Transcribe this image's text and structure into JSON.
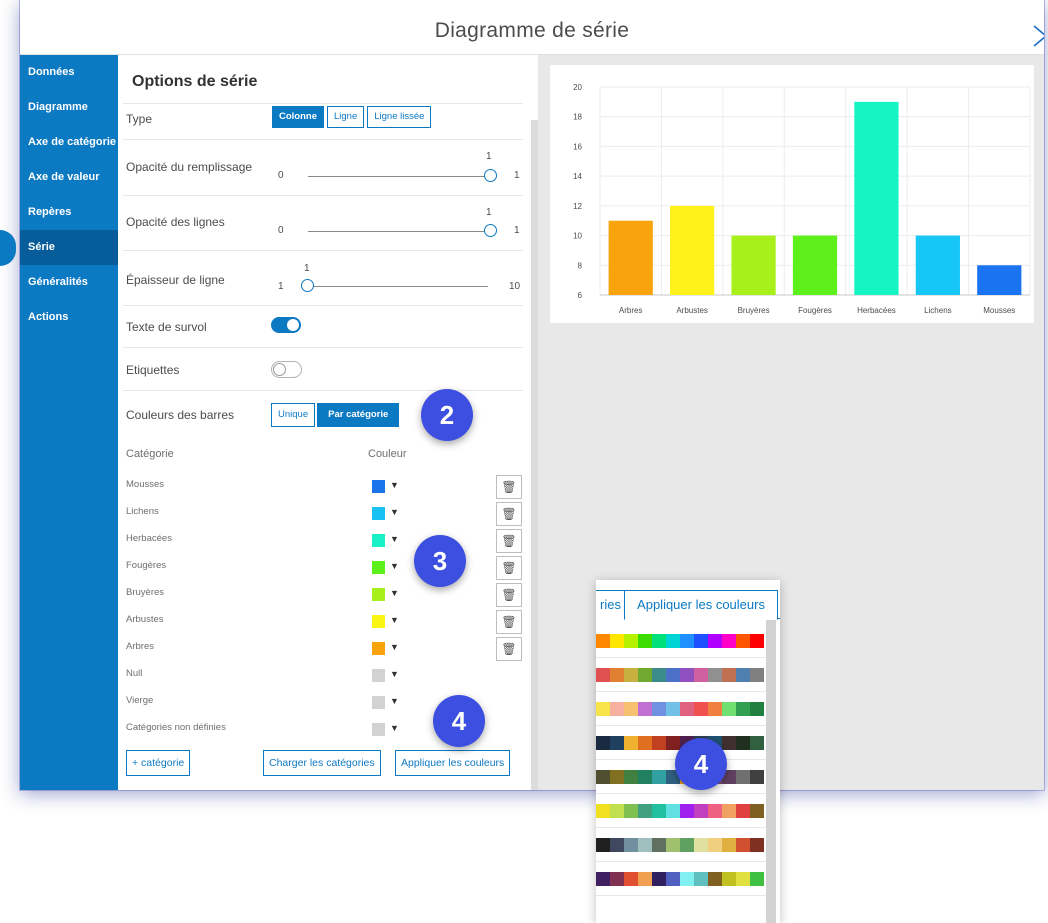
{
  "dialog": {
    "title": "Diagramme de série"
  },
  "sidebar": {
    "items": [
      {
        "label": "Données",
        "active": false
      },
      {
        "label": "Diagramme",
        "active": false
      },
      {
        "label": "Axe de catégorie",
        "active": false
      },
      {
        "label": "Axe de valeur",
        "active": false
      },
      {
        "label": "Repères",
        "active": false
      },
      {
        "label": "Série",
        "active": true
      },
      {
        "label": "Généralités",
        "active": false
      },
      {
        "label": "Actions",
        "active": false
      }
    ]
  },
  "panel": {
    "title": "Options de série",
    "type": {
      "label": "Type",
      "options": [
        "Colonne",
        "Ligne",
        "Ligne lissée"
      ],
      "selected": "Colonne"
    },
    "fill_opacity": {
      "label": "Opacité du remplissage",
      "min": "0",
      "max": "1",
      "value": "1"
    },
    "line_opacity": {
      "label": "Opacité des lignes",
      "min": "0",
      "max": "1",
      "value": "1"
    },
    "line_width": {
      "label": "Épaisseur de ligne",
      "min": "1",
      "max": "10",
      "value": "1"
    },
    "hover_text": {
      "label": "Texte de survol",
      "on": true
    },
    "labels": {
      "label": "Etiquettes",
      "on": false
    },
    "bar_colors": {
      "label": "Couleurs des barres",
      "options": [
        "Unique",
        "Par catégorie"
      ],
      "selected": "Par catégorie"
    },
    "categories_header": {
      "category": "Catégorie",
      "color": "Couleur"
    },
    "categories": [
      {
        "name": "Mousses",
        "color": "#1a73e8",
        "deletable": true
      },
      {
        "name": "Lichens",
        "color": "#17c1f2",
        "deletable": true
      },
      {
        "name": "Herbacées",
        "color": "#19f0c6",
        "deletable": true
      },
      {
        "name": "Fougères",
        "color": "#5ef01a",
        "deletable": true
      },
      {
        "name": "Bruyères",
        "color": "#a8f01a",
        "deletable": true
      },
      {
        "name": "Arbustes",
        "color": "#faf514",
        "deletable": true
      },
      {
        "name": "Arbres",
        "color": "#faa40d",
        "deletable": true
      },
      {
        "name": "Null",
        "color": "#d2d2d2",
        "deletable": false
      },
      {
        "name": "Vierge",
        "color": "#d2d2d2",
        "deletable": false
      },
      {
        "name": "Catégories non définies",
        "color": "#d2d2d2",
        "deletable": false
      }
    ],
    "add_category": "+ catégorie",
    "load_categories": "Charger les catégories",
    "apply_colors": "Appliquer les couleurs"
  },
  "chart_data": {
    "type": "bar",
    "categories": [
      "Arbres",
      "Arbustes",
      "Bruyères",
      "Fougères",
      "Herbacées",
      "Lichens",
      "Mousses"
    ],
    "values": [
      11,
      12,
      10,
      10,
      19,
      10,
      8
    ],
    "colors": [
      "#faa40d",
      "#fff21a",
      "#a8f01a",
      "#5ef01a",
      "#14f5c3",
      "#16c6f5",
      "#1a73f0"
    ],
    "yticks": [
      "6",
      "8",
      "10",
      "12",
      "14",
      "16",
      "18",
      "20"
    ],
    "ylim": [
      6,
      20
    ],
    "grid": true
  },
  "badges": [
    "2",
    "3",
    "4",
    "4"
  ],
  "palette_popup": {
    "tab_partial": "ries",
    "tab_apply": "Appliquer les couleurs",
    "rows": [
      [
        "#ff8800",
        "#ffe600",
        "#b5f000",
        "#3ddc00",
        "#00e07a",
        "#00d4d4",
        "#1e90ff",
        "#1e50ff",
        "#b000ff",
        "#ff00c8",
        "#ff5500",
        "#ff0000"
      ],
      [
        "#e05050",
        "#e08030",
        "#c8b040",
        "#70a830",
        "#3c8c8c",
        "#4c70c8",
        "#9050c0",
        "#d060a0",
        "#909090",
        "#c07050",
        "#5080b0",
        "#808080"
      ],
      [
        "#f7e34a",
        "#f7b0a0",
        "#f7c070",
        "#c070d0",
        "#7090e0",
        "#70c0e8",
        "#e06080",
        "#f05050",
        "#f08040",
        "#70e070",
        "#30a050",
        "#208040"
      ],
      [
        "#1a2a40",
        "#204060",
        "#f0b030",
        "#e07020",
        "#c04020",
        "#802020",
        "#502050",
        "#304050",
        "#205070",
        "#403030",
        "#203020",
        "#306040"
      ],
      [
        "#505030",
        "#807020",
        "#408040",
        "#208060",
        "#30a0a0",
        "#306080",
        "#f0a020",
        "#c06030",
        "#805070",
        "#604060",
        "#707070",
        "#404040"
      ],
      [
        "#f0e020",
        "#c0e050",
        "#80c050",
        "#40a080",
        "#20c0a0",
        "#60e0e0",
        "#a020f0",
        "#c040c0",
        "#f06080",
        "#f0a060",
        "#e04040",
        "#806020"
      ],
      [
        "#202020",
        "#404860",
        "#7090a0",
        "#a0c0c0",
        "#607060",
        "#a0c070",
        "#60a060",
        "#e0e0a0",
        "#f0d080",
        "#e0b040",
        "#d05030",
        "#803020"
      ],
      [
        "#402060",
        "#803050",
        "#e05030",
        "#f0a050",
        "#302060",
        "#5060c0",
        "#80f0f0",
        "#60c0c0",
        "#806020",
        "#c0c020",
        "#e0e040",
        "#40c040"
      ]
    ]
  }
}
